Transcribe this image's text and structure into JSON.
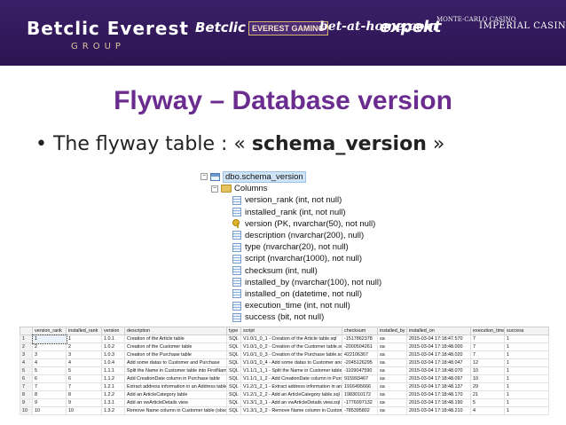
{
  "banner": {
    "brand": "Betclic Everest",
    "group": "GROUP",
    "logos": [
      "Betclic",
      "EVEREST GAMING",
      "bet-at-home.com",
      "expekt",
      "MONTE-CARLO CASINO",
      "IMPERIAL CASINO"
    ],
    "background": "#2c1452"
  },
  "title": "Flyway – Database version",
  "bullet": {
    "prefix": "The flyway table : « ",
    "bold": "schema_version",
    "suffix": " »"
  },
  "tree": {
    "table": "dbo.schema_version",
    "folder": "Columns",
    "columns": [
      {
        "label": "version_rank (int, not null)",
        "icon": "column-icon"
      },
      {
        "label": "installed_rank (int, not null)",
        "icon": "column-icon"
      },
      {
        "label": "version (PK, nvarchar(50), not null)",
        "icon": "key-icon"
      },
      {
        "label": "description (nvarchar(200), null)",
        "icon": "column-icon"
      },
      {
        "label": "type (nvarchar(20), not null)",
        "icon": "column-icon"
      },
      {
        "label": "script (nvarchar(1000), not null)",
        "icon": "column-icon"
      },
      {
        "label": "checksum (int, null)",
        "icon": "column-icon"
      },
      {
        "label": "installed_by (nvarchar(100), not null)",
        "icon": "column-icon"
      },
      {
        "label": "installed_on (datetime, not null)",
        "icon": "column-icon"
      },
      {
        "label": "execution_time (int, not null)",
        "icon": "column-icon"
      },
      {
        "label": "success (bit, not null)",
        "icon": "column-icon"
      }
    ]
  },
  "grid": {
    "headers": [
      "",
      "version_rank",
      "installed_rank",
      "version",
      "description",
      "type",
      "script",
      "checksum",
      "installed_by",
      "installed_on",
      "execution_time",
      "success"
    ],
    "rows": [
      [
        "1",
        "1",
        "1",
        "1.0.1",
        "Creation of the Article table",
        "SQL",
        "V1.0/1_0_1 - Creation of the Article table.sql",
        "-1517862378",
        "sa",
        "2015-03-04 17:18:47.570",
        "7",
        "1"
      ],
      [
        "2",
        "2",
        "2",
        "1.0.2",
        "Creation of the Customer table",
        "SQL",
        "V1.0/1_0_2 - Creation of the Customer table.sql",
        "-2000504261",
        "sa",
        "2015-03-04 17:18:48.000",
        "7",
        "1"
      ],
      [
        "3",
        "3",
        "3",
        "1.0.3",
        "Creation of the Purchase table",
        "SQL",
        "V1.0/1_0_3 - Creation of the Purchase table.sql",
        "422106367",
        "sa",
        "2015-03-04 17:18:48.020",
        "7",
        "1"
      ],
      [
        "4",
        "4",
        "4",
        "1.0.4",
        "Add some datas to Customer and Purchase",
        "SQL",
        "V1.0/1_0_4 - Add some datas to Customer and Purc...",
        "-2045126295",
        "sa",
        "2015-03-04 17:18:48.047",
        "12",
        "1"
      ],
      [
        "5",
        "5",
        "5",
        "1.1.1",
        "Split the Name in Customer table into FirstName and...",
        "SQL",
        "V1.1/1_1_1 - Split the Name in Customer table into Fi...",
        "-1109047590",
        "sa",
        "2015-03-04 17:18:48.070",
        "10",
        "1"
      ],
      [
        "6",
        "6",
        "6",
        "1.1.2",
        "Add CreationDate column in Purchase table",
        "SQL",
        "V1.1/1_1_2 - Add CreationDate column in Purchase ...",
        "915993467",
        "sa",
        "2015-03-04 17:18:48.097",
        "10",
        "1"
      ],
      [
        "7",
        "7",
        "7",
        "1.2.1",
        "Extract address information in an Address table",
        "SQL",
        "V1.2/1_2_1 - Extract address information in an Addre...",
        "1916495666",
        "sa",
        "2015-03-04 17:18:48.137",
        "29",
        "1"
      ],
      [
        "8",
        "8",
        "8",
        "1.2.2",
        "Add an ArticleCategory table",
        "SQL",
        "V1.2/1_2_2 - Add an ArticleCategory table.sql",
        "1983010172",
        "sa",
        "2015-03-04 17:18:48.170",
        "21",
        "1"
      ],
      [
        "9",
        "9",
        "9",
        "1.3.1",
        "Add an vwArticleDetails view",
        "SQL",
        "V1.3/1_3_1 - Add an vwArticleDetails view.sql",
        "-1776097132",
        "sa",
        "2015-03-04 17:18:48.190",
        "5",
        "1"
      ],
      [
        "10",
        "10",
        "10",
        "1.3.2",
        "Remove Name column in Customer table (obsolete s...",
        "SQL",
        "V1.3/1_3_2 - Remove Name column in Customer tab...",
        "-785395802",
        "sa",
        "2015-03-04 17:18:48.210",
        "4",
        "1"
      ]
    ]
  }
}
